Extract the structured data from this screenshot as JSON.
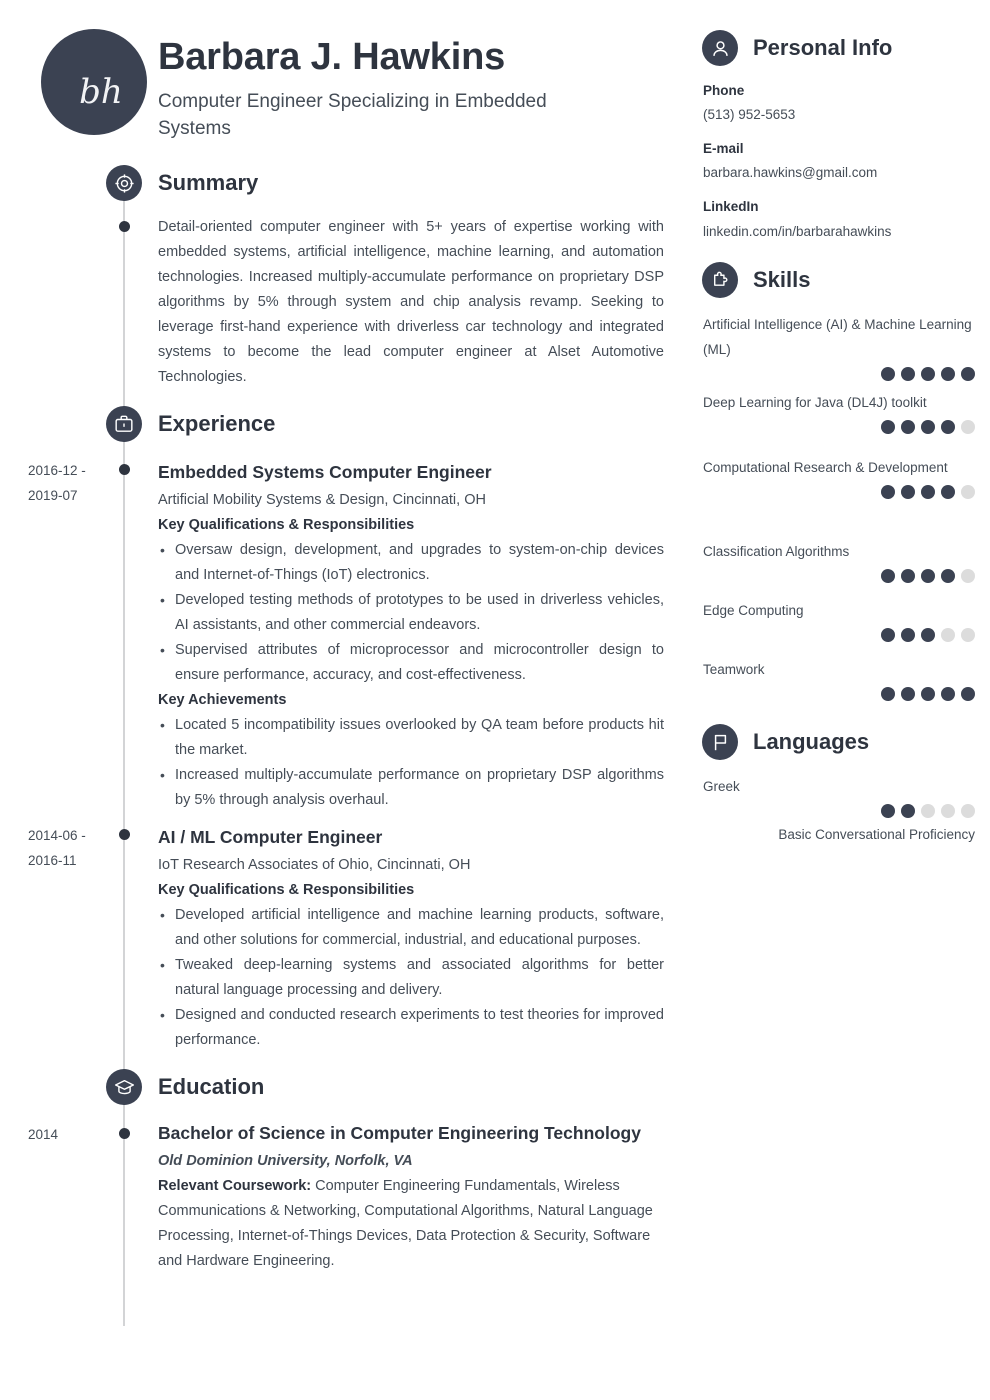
{
  "header": {
    "initials": "bh",
    "name": "Barbara J. Hawkins",
    "job_title": "Computer Engineer Specializing in Embedded Systems"
  },
  "sections": {
    "summary_title": "Summary",
    "experience_title": "Experience",
    "education_title": "Education"
  },
  "summary": {
    "text": "Detail-oriented computer engineer with 5+ years of expertise working with embedded systems, artificial intelligence, machine learning, and automation technologies. Increased multiply-accumulate performance on proprietary DSP algorithms by 5% through system and chip analysis revamp. Seeking to leverage first-hand experience with driverless car technology and integrated systems to become the lead computer engineer at Alset Automotive Technologies."
  },
  "experience": [
    {
      "date": "2016-12 - 2019-07",
      "title": "Embedded Systems Computer Engineer",
      "company": "Artificial Mobility Systems & Design, Cincinnati, OH",
      "groups": [
        {
          "heading": "Key Qualifications & Responsibilities",
          "bullets": [
            "Oversaw design, development, and upgrades to system-on-chip devices and Internet-of-Things (IoT) electronics.",
            "Developed testing methods of prototypes to be used in driverless vehicles, AI assistants, and other commercial endeavors.",
            "Supervised attributes of microprocessor and microcontroller design to ensure performance, accuracy, and cost-effectiveness."
          ]
        },
        {
          "heading": "Key Achievements",
          "bullets": [
            "Located 5 incompatibility issues overlooked by QA team before products hit the market.",
            "Increased multiply-accumulate performance on proprietary DSP algorithms by 5% through analysis overhaul."
          ]
        }
      ]
    },
    {
      "date": "2014-06 - 2016-11",
      "title": "AI / ML Computer Engineer",
      "company": "IoT Research Associates of Ohio, Cincinnati, OH",
      "groups": [
        {
          "heading": "Key Qualifications & Responsibilities",
          "bullets": [
            "Developed artificial intelligence and machine learning products, software, and other solutions for commercial, industrial, and educational purposes.",
            "Tweaked deep-learning systems and associated algorithms for better natural language processing and delivery.",
            "Designed and conducted research experiments to test theories for improved performance."
          ]
        }
      ]
    }
  ],
  "education": [
    {
      "date": "2014",
      "degree": "Bachelor of Science in Computer Engineering Technology",
      "school": "Old Dominion University, Norfolk, VA",
      "coursework_label": "Relevant Coursework:",
      "coursework": "Computer Engineering Fundamentals, Wireless Communications & Networking, Computational Algorithms, Natural Language Processing, Internet-of-Things Devices, Data Protection & Security, Software and Hardware Engineering."
    }
  ],
  "personal_info": {
    "title": "Personal Info",
    "items": [
      {
        "label": "Phone",
        "value": "(513) 952-5653"
      },
      {
        "label": "E-mail",
        "value": "barbara.hawkins@gmail.com"
      },
      {
        "label": "LinkedIn",
        "value": "linkedin.com/in/barbarahawkins"
      }
    ]
  },
  "skills": {
    "title": "Skills",
    "max_rating": 5,
    "items": [
      {
        "name": "Artificial Intelligence (AI) & Machine Learning (ML)",
        "rating": 5
      },
      {
        "name": "Deep Learning for Java (DL4J) toolkit",
        "rating": 4
      },
      {
        "name": "Computational Research & Development",
        "rating": 4
      },
      {
        "name": "Classification Algorithms",
        "rating": 4
      },
      {
        "name": "Edge Computing",
        "rating": 3
      },
      {
        "name": "Teamwork",
        "rating": 5
      }
    ]
  },
  "languages": {
    "title": "Languages",
    "max_rating": 5,
    "items": [
      {
        "name": "Greek",
        "rating": 2,
        "note": "Basic Conversational Proficiency"
      }
    ]
  },
  "colors": {
    "accent_dark": "#3b4252",
    "heading": "#2e343f",
    "body": "#454d57",
    "dot_off": "#dcdcdc",
    "rule": "#d3d4d6"
  }
}
